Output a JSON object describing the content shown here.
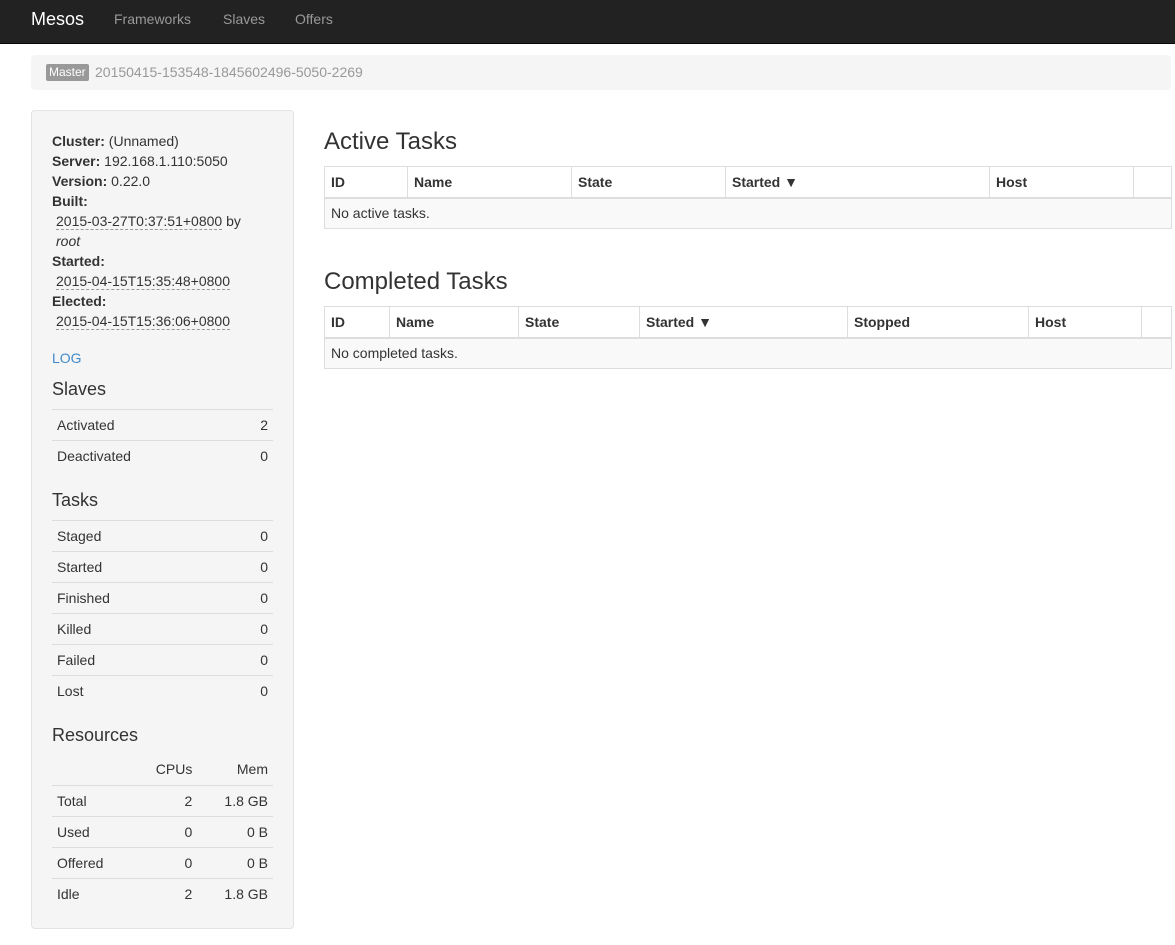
{
  "navbar": {
    "brand": "Mesos",
    "links": [
      "Frameworks",
      "Slaves",
      "Offers"
    ]
  },
  "breadcrumb": {
    "badge": "Master",
    "master_id": "20150415-153548-1845602496-5050-2269"
  },
  "sidebar": {
    "cluster_label": "Cluster:",
    "cluster_value": "(Unnamed)",
    "server_label": "Server:",
    "server_value": "192.168.1.110:5050",
    "version_label": "Version:",
    "version_value": "0.22.0",
    "built_label": "Built:",
    "built_value": "2015-03-27T0:37:51+0800",
    "built_by": "by",
    "built_user": "root",
    "started_label": "Started:",
    "started_value": "2015-04-15T15:35:48+0800",
    "elected_label": "Elected:",
    "elected_value": "2015-04-15T15:36:06+0800",
    "log_link": "LOG",
    "slaves_heading": "Slaves",
    "slaves": [
      {
        "label": "Activated",
        "value": "2"
      },
      {
        "label": "Deactivated",
        "value": "0"
      }
    ],
    "tasks_heading": "Tasks",
    "tasks": [
      {
        "label": "Staged",
        "value": "0"
      },
      {
        "label": "Started",
        "value": "0"
      },
      {
        "label": "Finished",
        "value": "0"
      },
      {
        "label": "Killed",
        "value": "0"
      },
      {
        "label": "Failed",
        "value": "0"
      },
      {
        "label": "Lost",
        "value": "0"
      }
    ],
    "resources_heading": "Resources",
    "resources_columns": [
      "CPUs",
      "Mem"
    ],
    "resources": [
      {
        "label": "Total",
        "cpus": "2",
        "mem": "1.8 GB"
      },
      {
        "label": "Used",
        "cpus": "0",
        "mem": "0 B"
      },
      {
        "label": "Offered",
        "cpus": "0",
        "mem": "0 B"
      },
      {
        "label": "Idle",
        "cpus": "2",
        "mem": "1.8 GB"
      }
    ]
  },
  "active_tasks": {
    "heading": "Active Tasks",
    "columns": [
      "ID",
      "Name",
      "State",
      "Started ▼",
      "Host",
      ""
    ],
    "empty_message": "No active tasks."
  },
  "completed_tasks": {
    "heading": "Completed Tasks",
    "columns": [
      "ID",
      "Name",
      "State",
      "Started ▼",
      "Stopped",
      "Host",
      ""
    ],
    "empty_message": "No completed tasks."
  }
}
